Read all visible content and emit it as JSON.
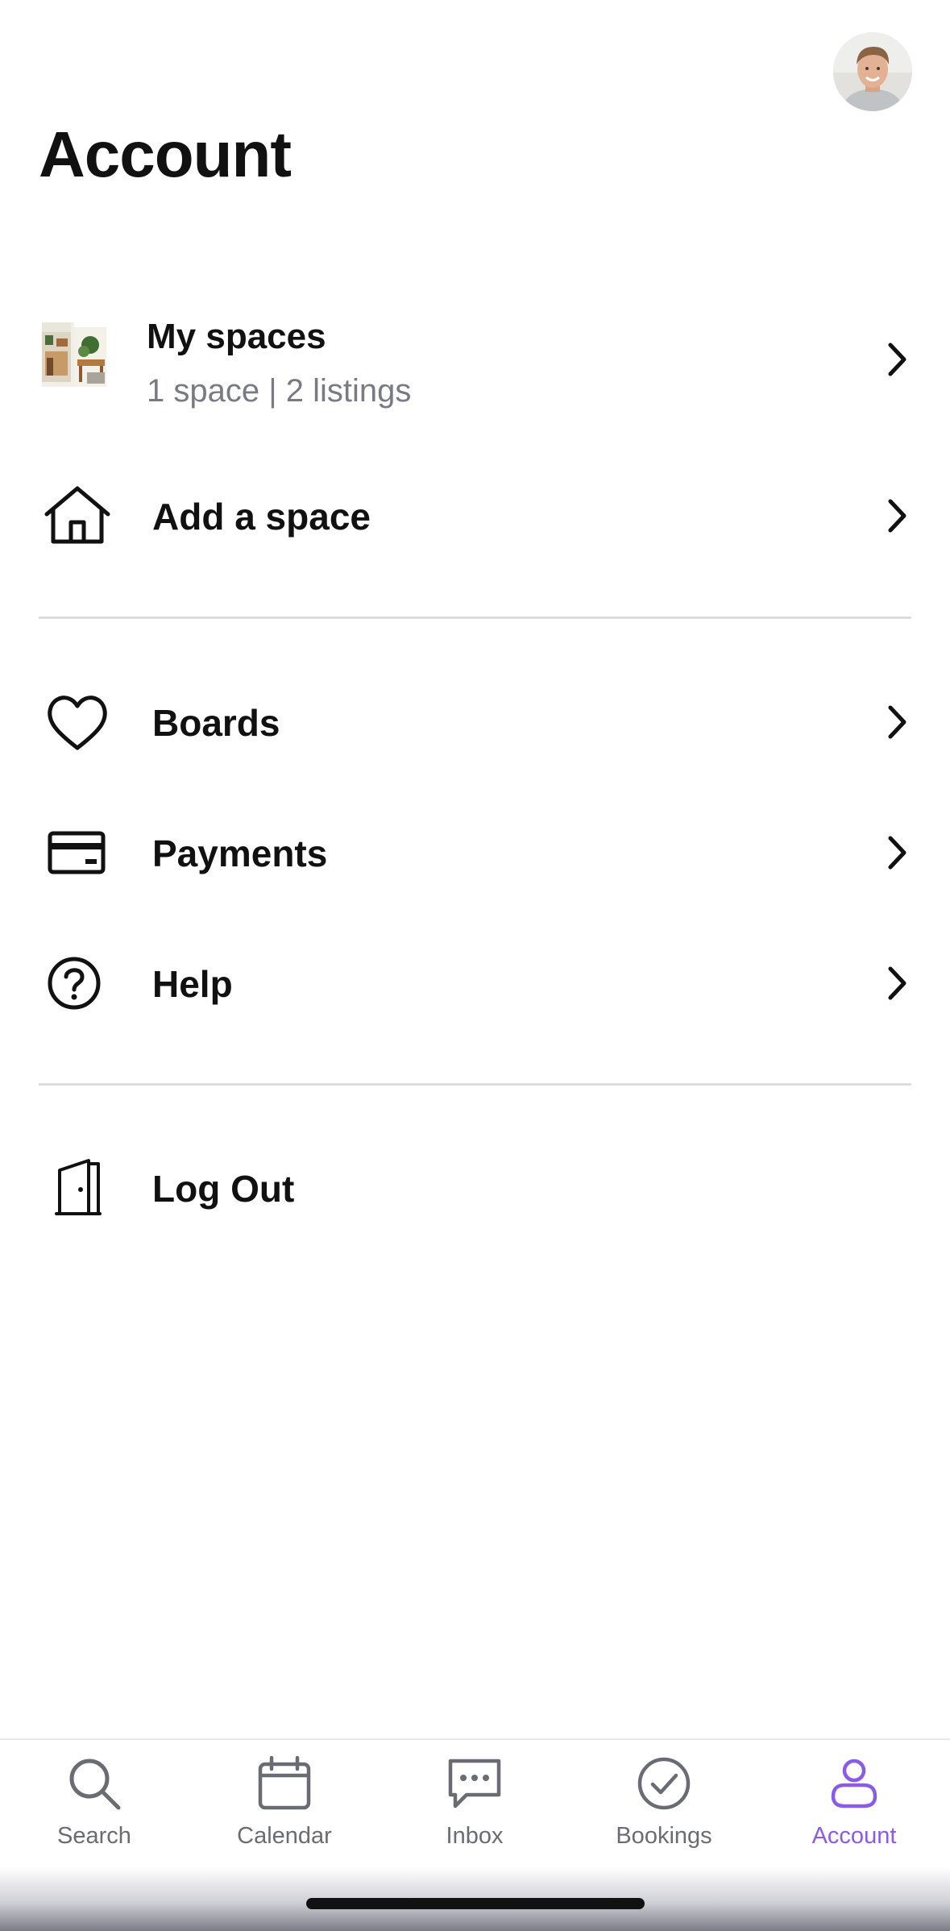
{
  "header": {
    "title": "Account",
    "avatar_icon": "user-avatar-photo"
  },
  "sections": {
    "spaces": {
      "my_spaces": {
        "label": "My spaces",
        "subtitle": "1 space | 2 listings",
        "icon": "space-thumbnail"
      },
      "add_space": {
        "label": "Add a space",
        "icon": "house-icon"
      }
    },
    "general": {
      "boards": {
        "label": "Boards",
        "icon": "heart-icon"
      },
      "payments": {
        "label": "Payments",
        "icon": "credit-card-icon"
      },
      "help": {
        "label": "Help",
        "icon": "question-circle-icon"
      }
    },
    "session": {
      "logout": {
        "label": "Log Out",
        "icon": "door-icon"
      }
    }
  },
  "tabbar": {
    "active_color": "#8a5be8",
    "inactive_color": "#6b6b73",
    "active_tab": "Account",
    "tabs": [
      {
        "label": "Search",
        "icon": "search-icon"
      },
      {
        "label": "Calendar",
        "icon": "calendar-icon"
      },
      {
        "label": "Inbox",
        "icon": "chat-icon"
      },
      {
        "label": "Bookings",
        "icon": "check-circle-icon"
      },
      {
        "label": "Account",
        "icon": "person-icon"
      }
    ]
  }
}
